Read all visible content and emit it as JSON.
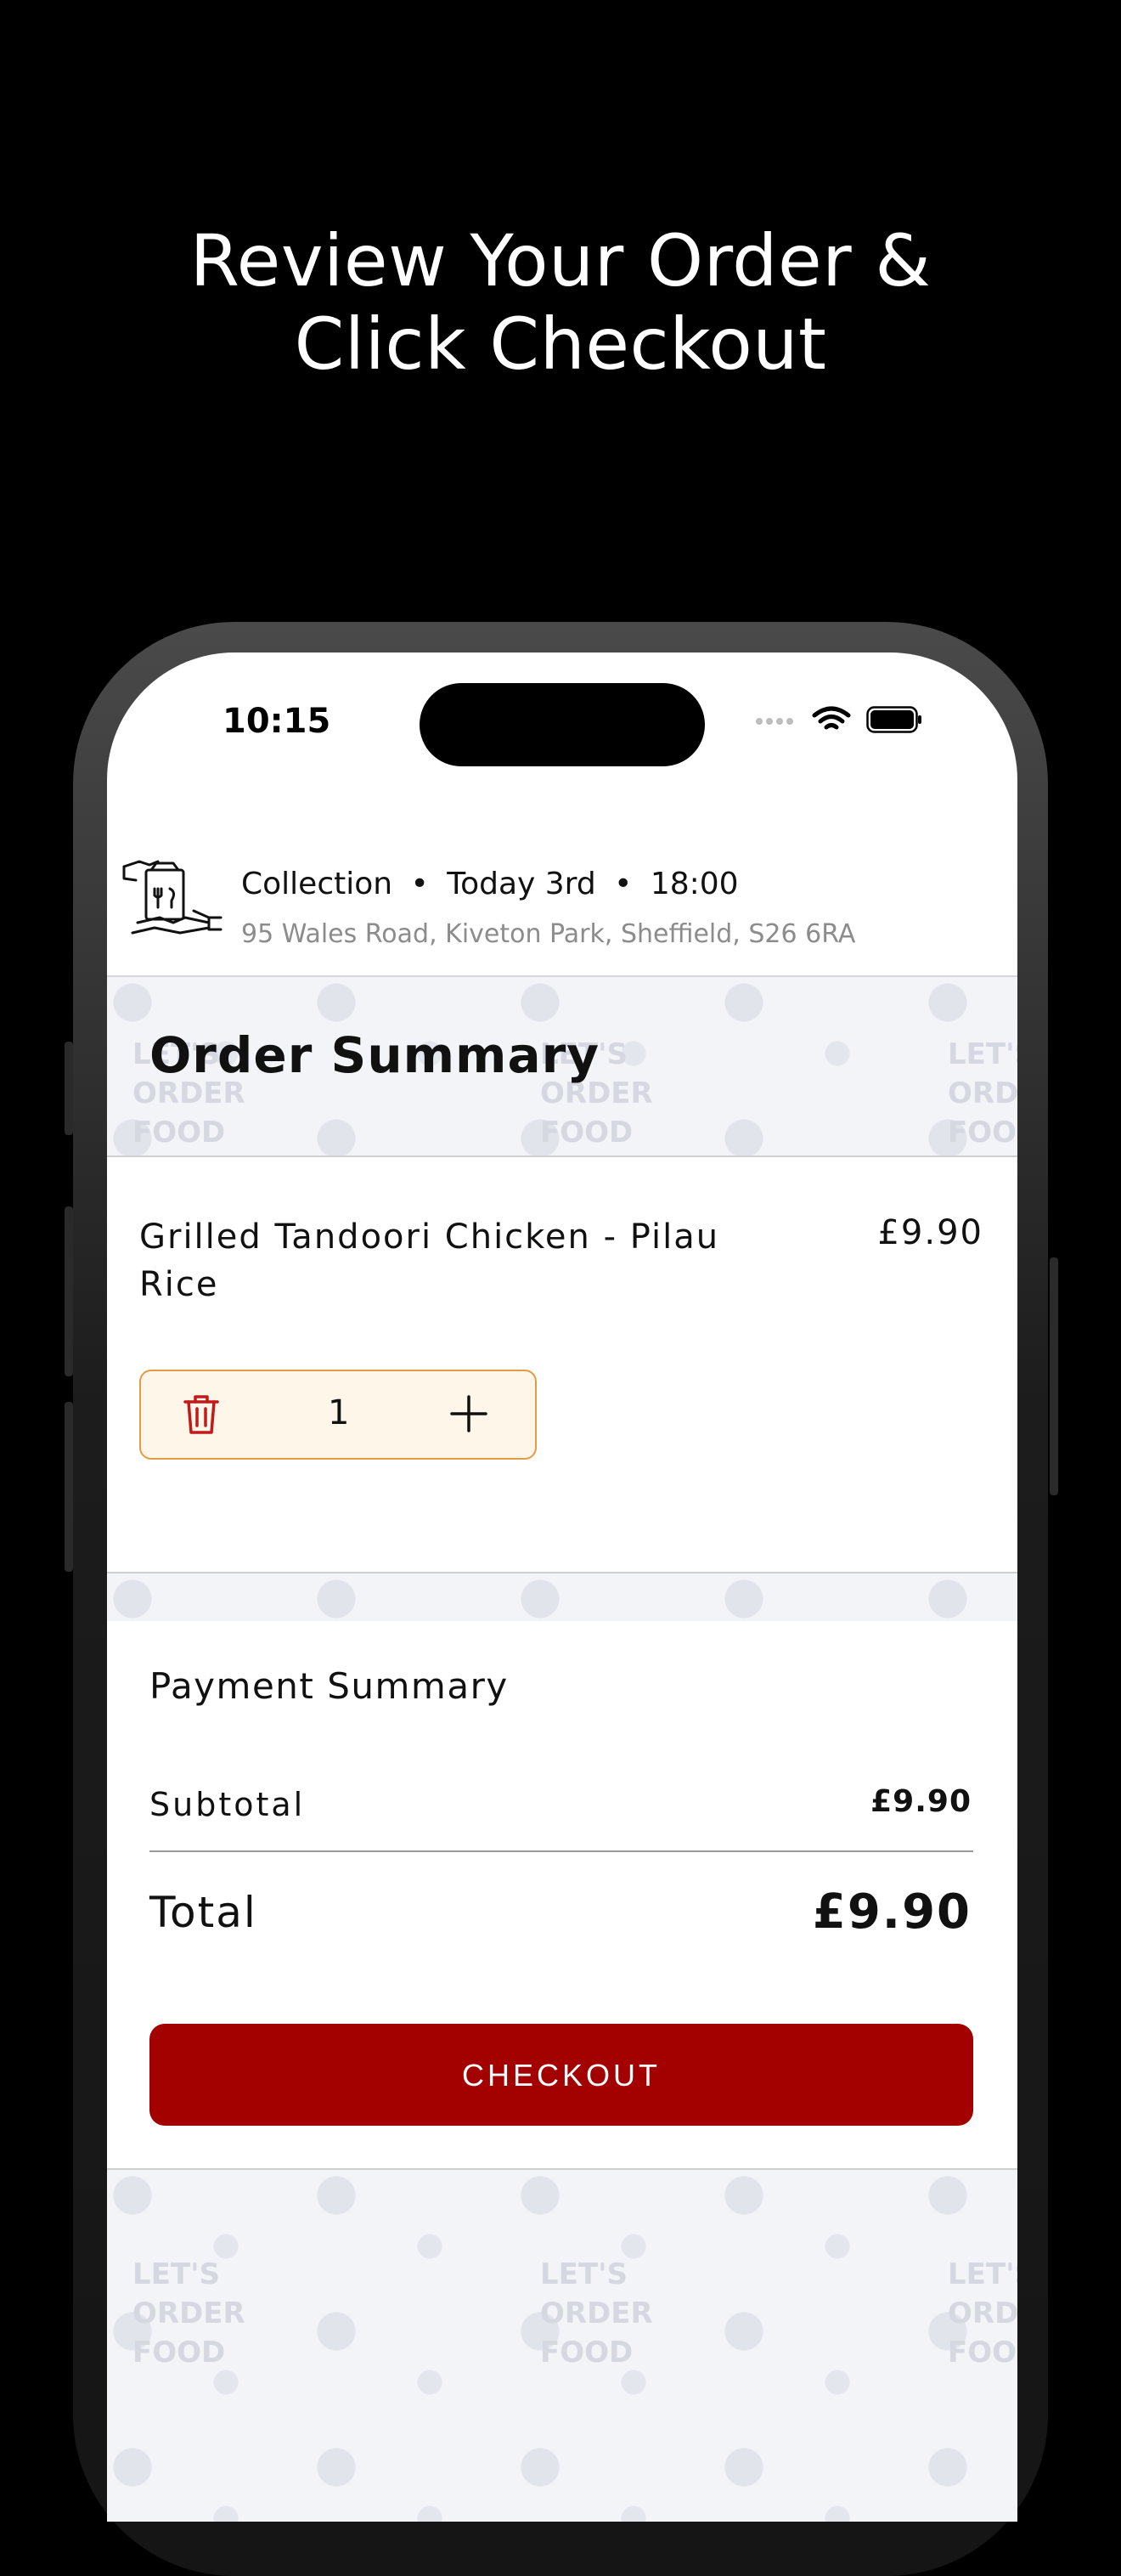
{
  "headline": {
    "line1": "Review Your Order &",
    "line2": "Click Checkout"
  },
  "status_bar": {
    "time": "10:15"
  },
  "order_info": {
    "mode": "Collection",
    "day": "Today 3rd",
    "time": "18:00",
    "separator": "•",
    "address": "95 Wales Road, Kiveton Park, Sheffield, S26  6RA"
  },
  "order_summary": {
    "title": "Order Summary",
    "background_text": "LET'S ORDER FOOD",
    "items": [
      {
        "name": "Grilled Tandoori Chicken - Pilau Rice",
        "price": "£9.90",
        "quantity": "1"
      }
    ]
  },
  "payment_summary": {
    "title": "Payment Summary",
    "subtotal_label": "Subtotal",
    "subtotal_value": "£9.90",
    "total_label": "Total",
    "total_value": "£9.90",
    "checkout_label": "CHECKOUT"
  },
  "colors": {
    "accent": "#a30000",
    "stepper_border": "#e59b45",
    "stepper_bg": "#fff6ea",
    "background": "#000000"
  },
  "icons": [
    "collection-bag-icon",
    "trash-icon",
    "plus-icon",
    "wifi-icon",
    "battery-icon",
    "signal-icon"
  ]
}
